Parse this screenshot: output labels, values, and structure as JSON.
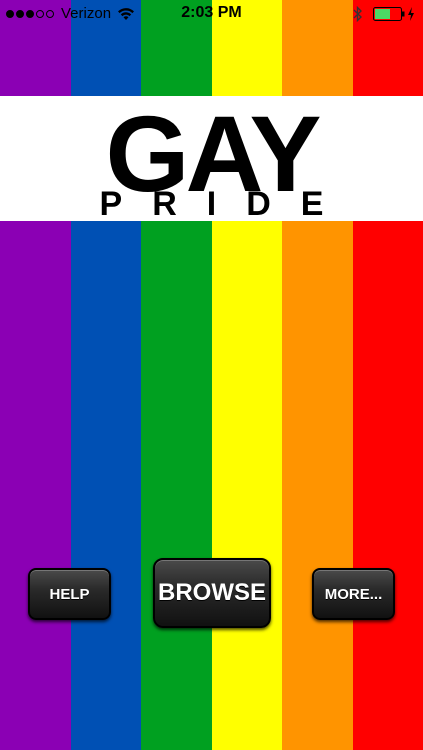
{
  "colors": {
    "stripes": [
      "#8b00b4",
      "#0050b4",
      "#00a020",
      "#ffff00",
      "#ff9400",
      "#ff0000"
    ],
    "banner_background": "#ffffff",
    "battery_fill": "#4cd964"
  },
  "status_bar": {
    "signal_dots_filled": 3,
    "signal_dots_total": 5,
    "carrier": "Verizon",
    "time": "2:03 PM",
    "icons": [
      "wifi-icon",
      "bluetooth-icon",
      "battery-icon",
      "charging-bolt-icon"
    ],
    "battery_level": 0.6
  },
  "banner": {
    "title": "GAY",
    "subtitle": "PRIDE"
  },
  "buttons": {
    "help_label": "HELP",
    "browse_label": "BROWSE",
    "more_label": "MORE..."
  }
}
